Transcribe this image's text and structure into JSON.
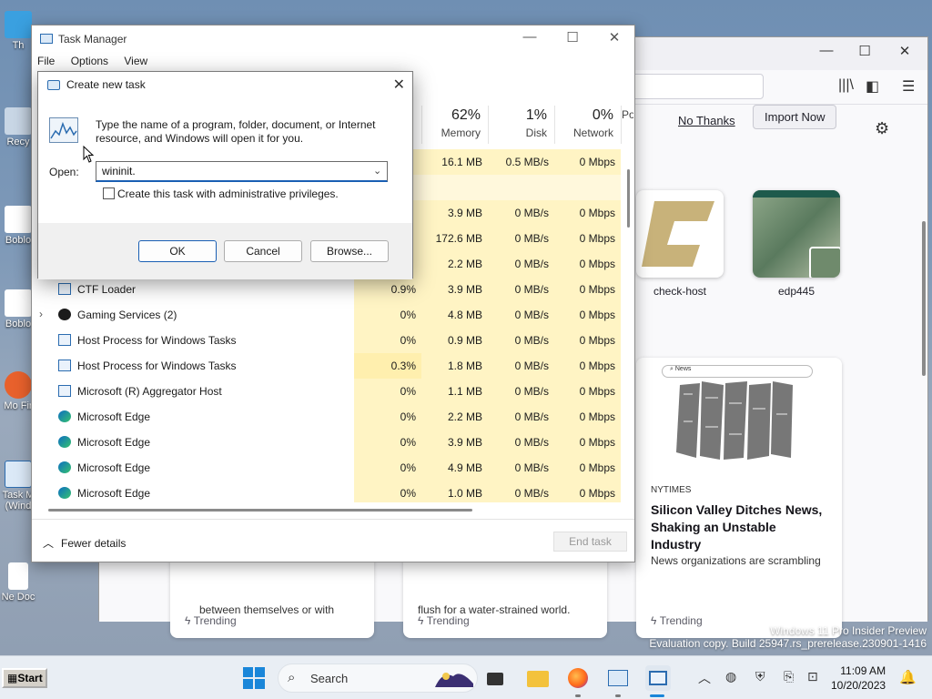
{
  "desktop": {
    "icons": [
      {
        "label": "Th"
      },
      {
        "label": "Recy"
      },
      {
        "label": "Boblo"
      },
      {
        "label": "Boblo"
      },
      {
        "label": "Mo Fir"
      },
      {
        "label": "Task M (Wind"
      },
      {
        "label": "Ne Doc"
      }
    ]
  },
  "browser": {
    "no_thanks": "No Thanks",
    "import_now": "Import Now",
    "shortcuts": [
      {
        "label": "check-host"
      },
      {
        "label": "edp445"
      }
    ],
    "cards": [
      {
        "text_top": "between themselves or with",
        "trending": "Trending"
      },
      {
        "text_top": "flush for a water-strained world.",
        "trending": "Trending"
      },
      {
        "source": "NYTIMES",
        "headline": "Silicon Valley Ditches News, Shaking an Unstable Industry",
        "subtext": "News organizations are scrambling",
        "trending": "Trending",
        "image_search": "News"
      }
    ]
  },
  "task_manager": {
    "title": "Task Manager",
    "menu": [
      "File",
      "Options",
      "View"
    ],
    "columns": [
      {
        "pct": "62%",
        "label": "Memory"
      },
      {
        "pct": "1%",
        "label": "Disk"
      },
      {
        "pct": "0%",
        "label": "Network"
      },
      {
        "pct": "",
        "label": "Po"
      }
    ],
    "rows": [
      {
        "name": "",
        "cpu": "",
        "mem": "16.1 MB",
        "disk": "0.5 MB/s",
        "net": "0 Mbps"
      },
      {
        "name": "",
        "cpu": "",
        "mem": "",
        "disk": "",
        "net": ""
      },
      {
        "name": "",
        "cpu": "",
        "mem": "3.9 MB",
        "disk": "0 MB/s",
        "net": "0 Mbps"
      },
      {
        "name": "",
        "cpu": "",
        "mem": "172.6 MB",
        "disk": "0 MB/s",
        "net": "0 Mbps"
      },
      {
        "name": "",
        "cpu": "",
        "mem": "2.2 MB",
        "disk": "0 MB/s",
        "net": "0 Mbps"
      },
      {
        "name": "CTF Loader",
        "cpu": "0.9%",
        "mem": "3.9 MB",
        "disk": "0 MB/s",
        "net": "0 Mbps"
      },
      {
        "name": "Gaming Services (2)",
        "cpu": "0%",
        "mem": "4.8 MB",
        "disk": "0 MB/s",
        "net": "0 Mbps"
      },
      {
        "name": "Host Process for Windows Tasks",
        "cpu": "0%",
        "mem": "0.9 MB",
        "disk": "0 MB/s",
        "net": "0 Mbps"
      },
      {
        "name": "Host Process for Windows Tasks",
        "cpu": "0.3%",
        "mem": "1.8 MB",
        "disk": "0 MB/s",
        "net": "0 Mbps"
      },
      {
        "name": "Microsoft (R) Aggregator Host",
        "cpu": "0%",
        "mem": "1.1 MB",
        "disk": "0 MB/s",
        "net": "0 Mbps"
      },
      {
        "name": "Microsoft Edge",
        "cpu": "0%",
        "mem": "2.2 MB",
        "disk": "0 MB/s",
        "net": "0 Mbps"
      },
      {
        "name": "Microsoft Edge",
        "cpu": "0%",
        "mem": "3.9 MB",
        "disk": "0 MB/s",
        "net": "0 Mbps"
      },
      {
        "name": "Microsoft Edge",
        "cpu": "0%",
        "mem": "4.9 MB",
        "disk": "0 MB/s",
        "net": "0 Mbps"
      },
      {
        "name": "Microsoft Edge",
        "cpu": "0%",
        "mem": "1.0 MB",
        "disk": "0 MB/s",
        "net": "0 Mbps"
      }
    ],
    "fewer_details": "Fewer details",
    "end_task": "End task"
  },
  "dialog": {
    "title": "Create new task",
    "message": "Type the name of a program, folder, document, or Internet resource, and Windows will open it for you.",
    "open_label": "Open:",
    "open_value": "wininit.",
    "admin_label": "Create this task with administrative privileges.",
    "ok": "OK",
    "cancel": "Cancel",
    "browse": "Browse..."
  },
  "watermark": {
    "line1": "Windows 11 Pro Insider Preview",
    "line2": "Evaluation copy. Build 25947.rs_prerelease.230901-1416"
  },
  "taskbar": {
    "start": "Start",
    "search": "Search",
    "time": "11:09 AM",
    "date": "10/20/2023"
  }
}
